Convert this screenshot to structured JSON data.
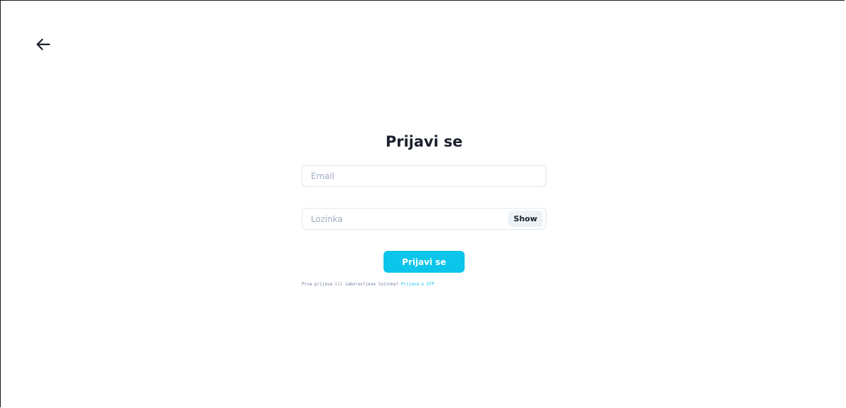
{
  "header": {
    "back_icon": "arrow-left-icon"
  },
  "login": {
    "title": "Prijavi se",
    "email_placeholder": "Email",
    "email_value": "",
    "password_placeholder": "Lozinka",
    "password_value": "",
    "show_label": "Show",
    "submit_label": "Prijavi se",
    "hint_text": "Prva prijava ili zaboravljena lozinka?",
    "otp_link_label": "Prijava s OTP"
  },
  "colors": {
    "accent": "#0bc5ea",
    "title": "#1a202c",
    "placeholder": "#a0aec0",
    "border": "#e2e8f0",
    "show_bg": "#edf2f7"
  }
}
